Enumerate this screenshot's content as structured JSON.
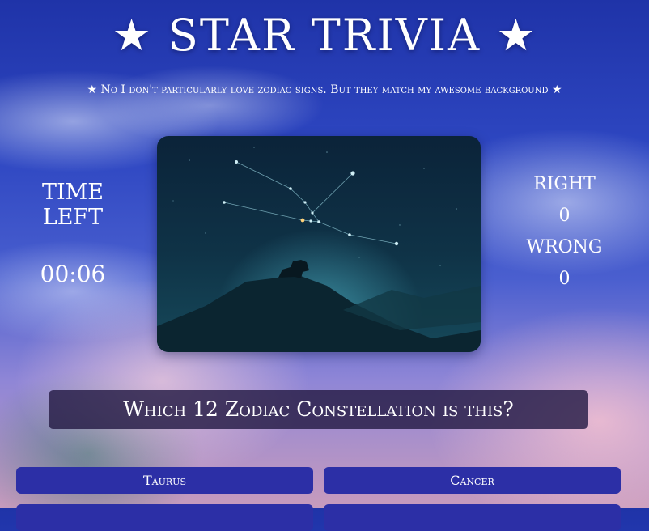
{
  "header": {
    "title": "★ STAR TRIVIA ★",
    "subtitle": "★ No I don't particularly love zodiac signs. But they match my awesome background ★"
  },
  "timer": {
    "label": "TIME LEFT",
    "value": "00:06"
  },
  "score": {
    "right_label": "RIGHT",
    "right_value": "0",
    "wrong_label": "WRONG",
    "wrong_value": "0"
  },
  "question": {
    "text": "Which 12 Zodiac Constellation is this?"
  },
  "answers": [
    {
      "label": "Taurus"
    },
    {
      "label": "Cancer"
    }
  ],
  "colors": {
    "answer_button": "#2c2fa6",
    "question_bar": "#261c46",
    "sky_top": "#1f33a8",
    "sky_bottom": "#c79bbd"
  }
}
